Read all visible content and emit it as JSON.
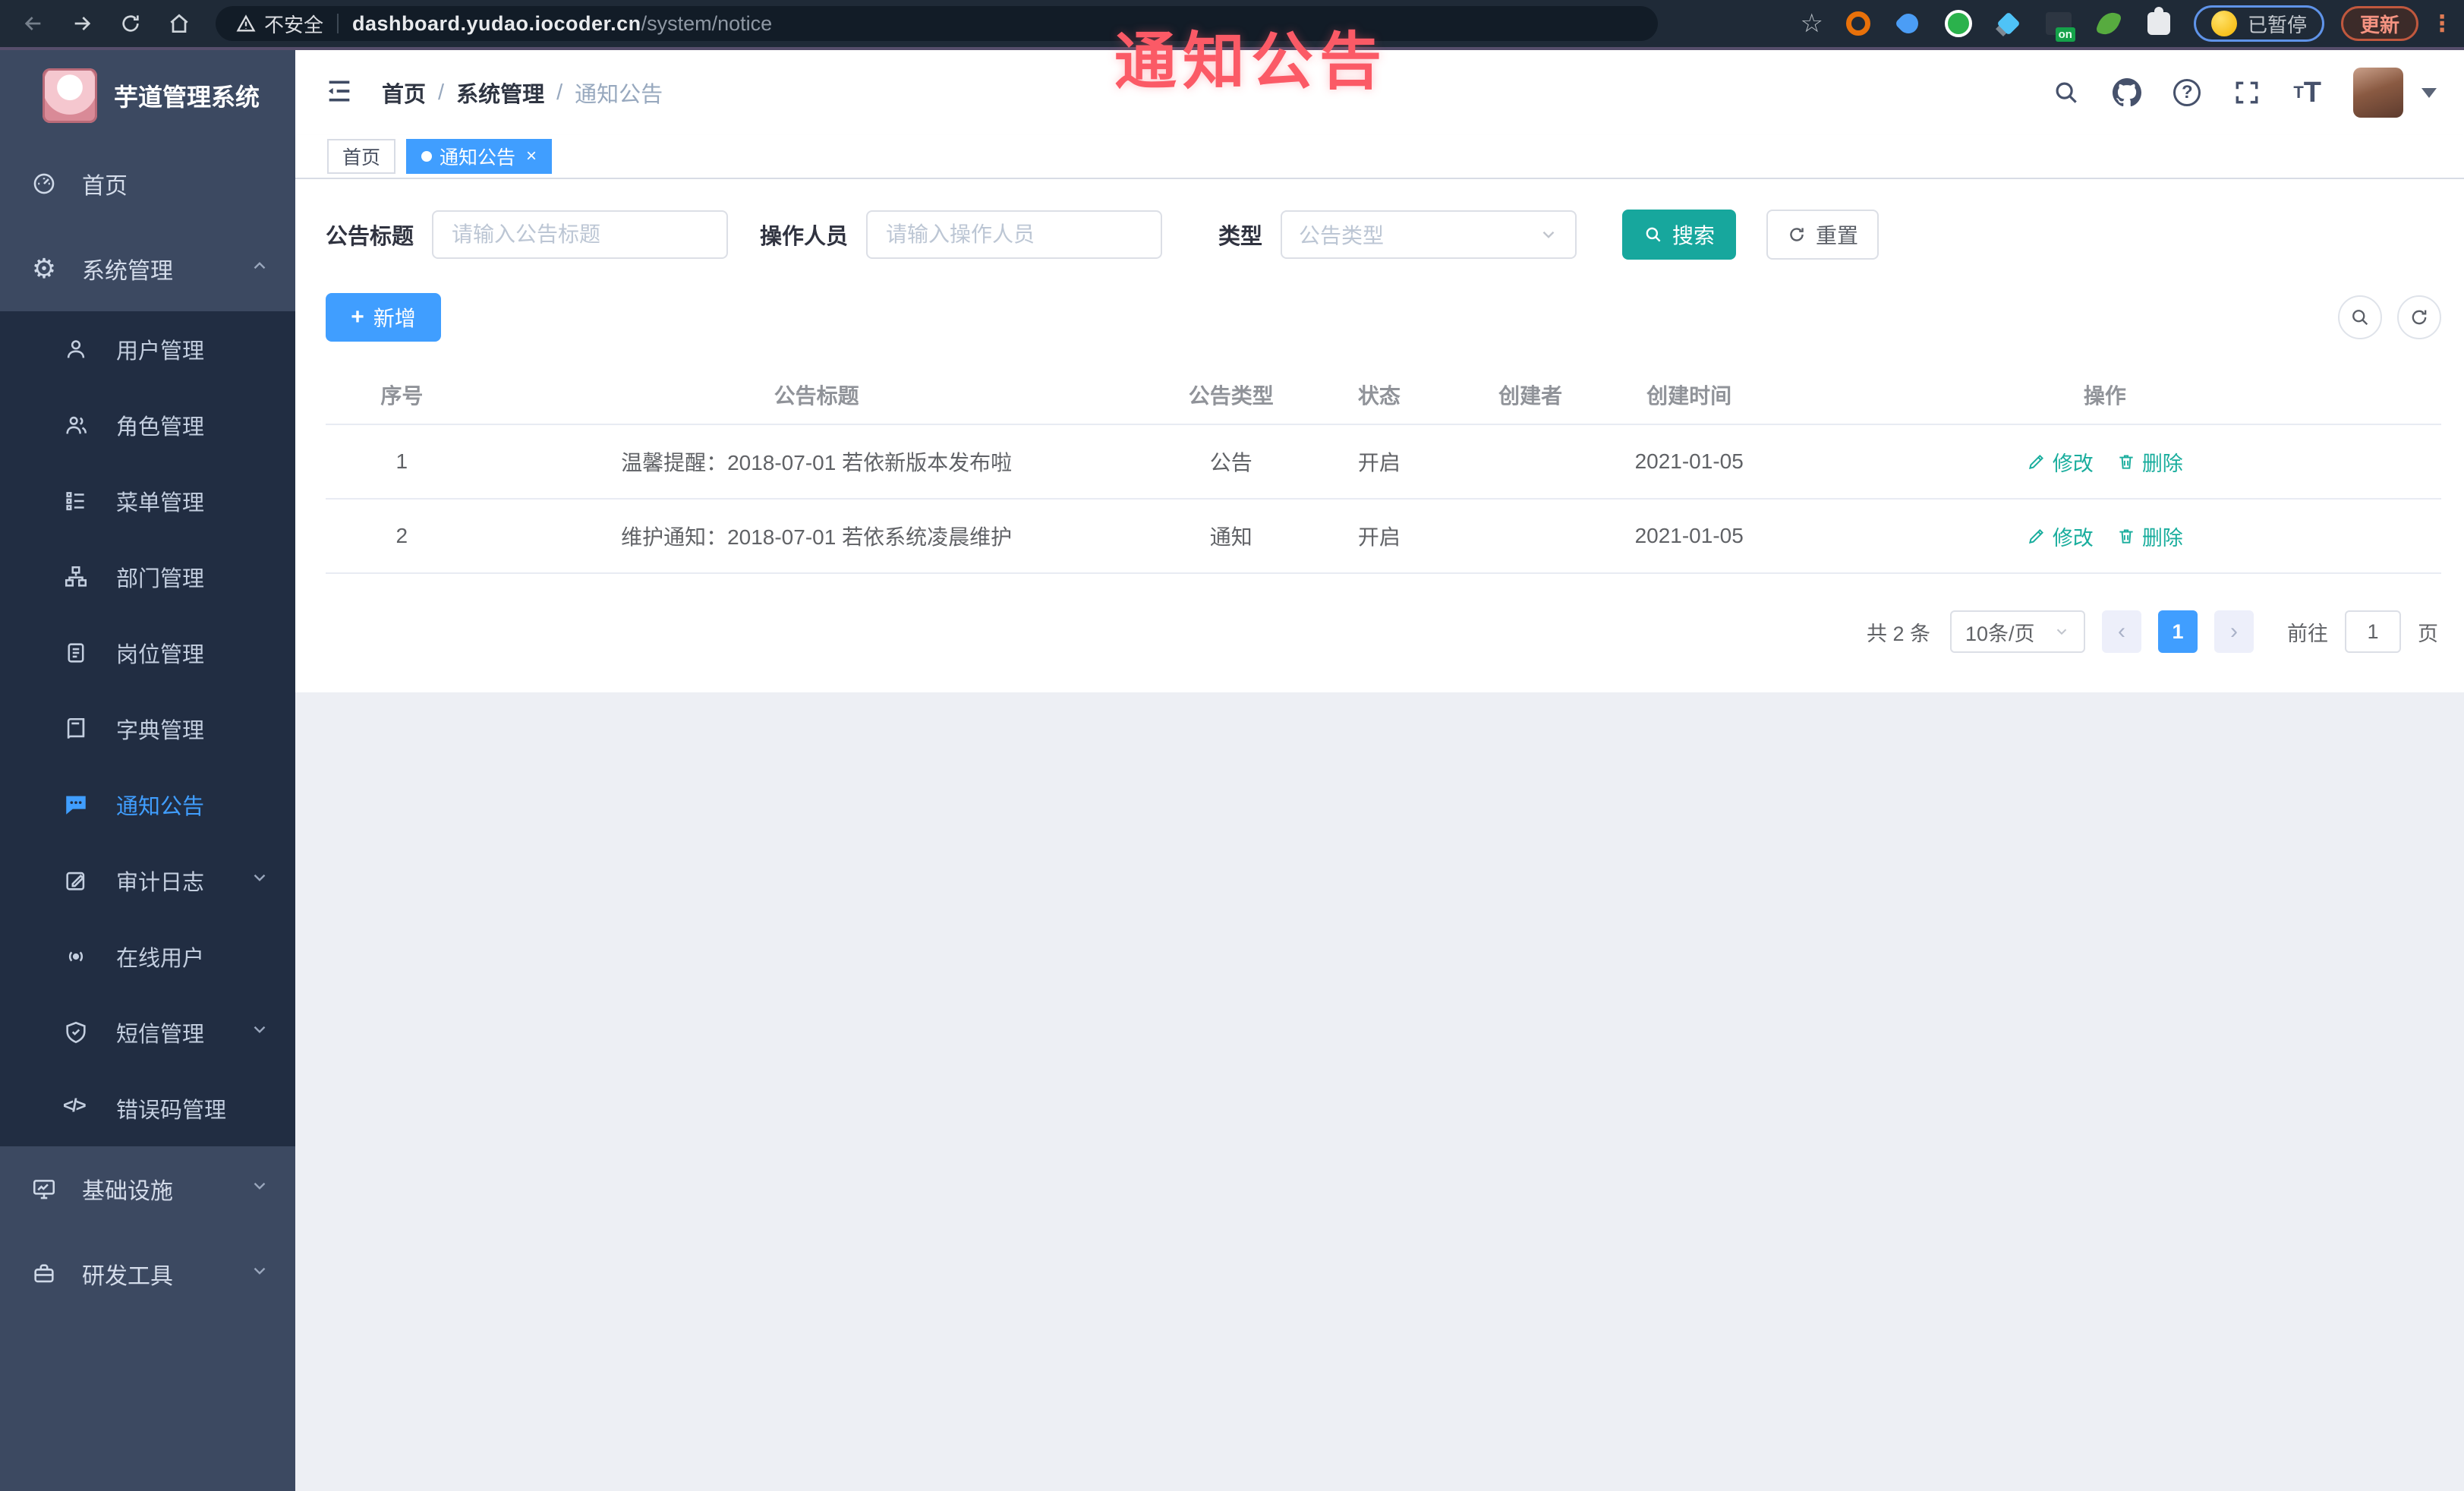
{
  "browser": {
    "security_text": "不安全",
    "url_host": "dashboard.yudao.iocoder.cn",
    "url_path": "/system/notice",
    "star": "☆",
    "on_badge": "on",
    "paused_text": "已暂停",
    "update_text": "更新",
    "menu_dots": "⋮"
  },
  "overlay": {
    "text": "通知公告"
  },
  "sidebar": {
    "logo_title": "芋道管理系统",
    "home": "首页",
    "system": "系统管理",
    "gear_glyph": "⚙",
    "submenu": [
      "用户管理",
      "角色管理",
      "菜单管理",
      "部门管理",
      "岗位管理",
      "字典管理",
      "通知公告",
      "审计日志",
      "在线用户",
      "短信管理",
      "错误码管理"
    ],
    "code_glyph": "</>",
    "infra": "基础设施",
    "devtools": "研发工具"
  },
  "breadcrumb": {
    "items": [
      "首页",
      "系统管理",
      "通知公告"
    ],
    "separator": "/"
  },
  "header_icons": {
    "question_glyph": "?",
    "font_small": "T",
    "font_large": "T"
  },
  "tags": {
    "home": "首页",
    "active": "通知公告",
    "close": "×"
  },
  "filters": {
    "title_label": "公告标题",
    "title_placeholder": "请输入公告标题",
    "operator_label": "操作人员",
    "operator_placeholder": "请输入操作人员",
    "type_label": "类型",
    "type_placeholder": "公告类型",
    "search": "搜索",
    "reset": "重置"
  },
  "toolbar": {
    "add": "新增",
    "plus": "+"
  },
  "table": {
    "headers": [
      "序号",
      "公告标题",
      "公告类型",
      "状态",
      "创建者",
      "创建时间",
      "操作"
    ],
    "rows": [
      {
        "no": "1",
        "title": "温馨提醒：2018-07-01 若依新版本发布啦",
        "type": "公告",
        "status": "开启",
        "creator": "",
        "time": "2021-01-05"
      },
      {
        "no": "2",
        "title": "维护通知：2018-07-01 若依系统凌晨维护",
        "type": "通知",
        "status": "开启",
        "creator": "",
        "time": "2021-01-05"
      }
    ],
    "edit": "修改",
    "remove": "删除"
  },
  "pagination": {
    "total": "共 2 条",
    "size": "10条/页",
    "prev": "‹",
    "next": "›",
    "page": "1",
    "goto": "前往",
    "goto_value": "1",
    "unit": "页"
  }
}
